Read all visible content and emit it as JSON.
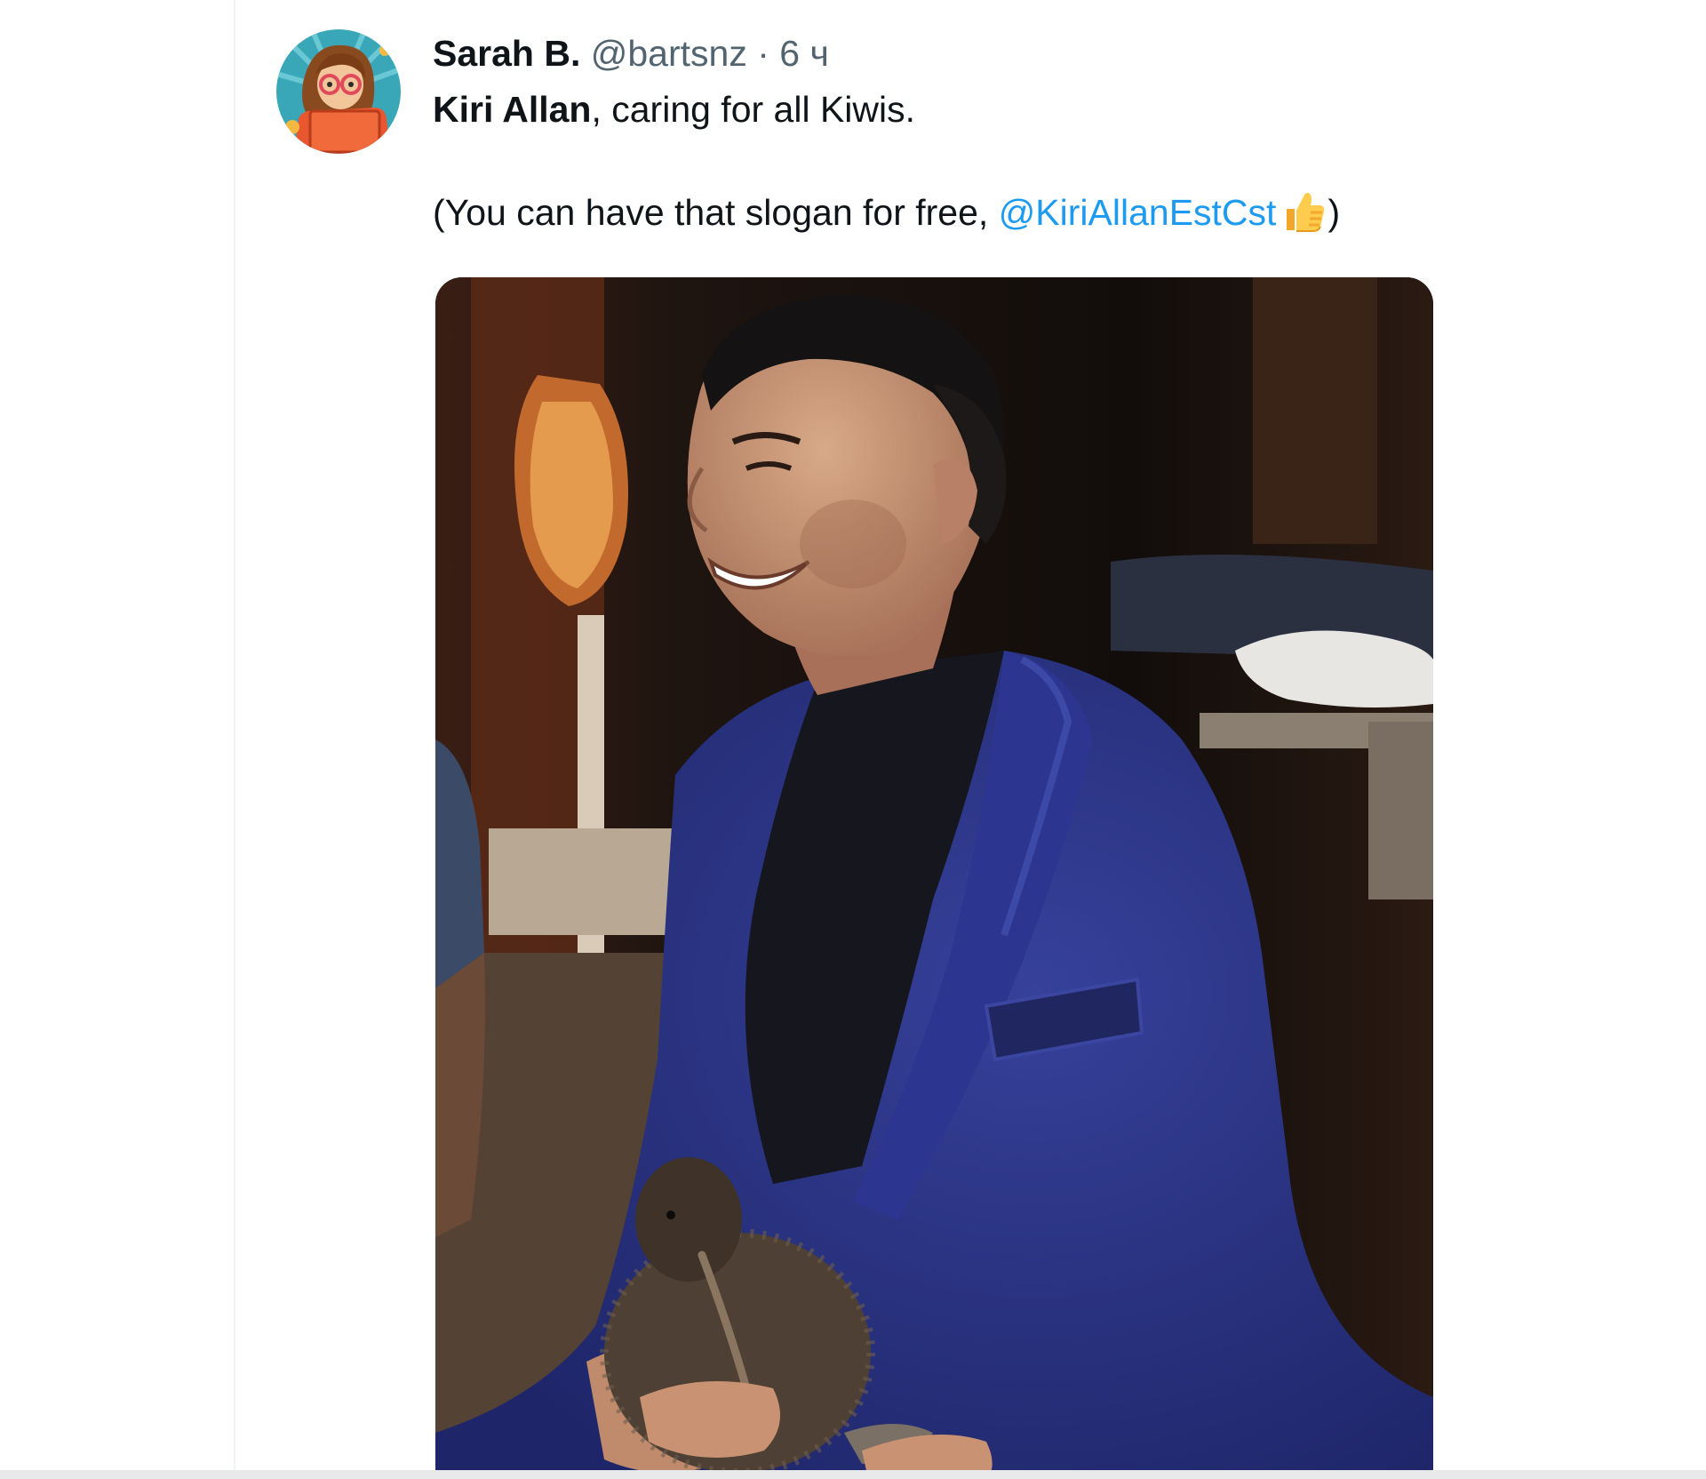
{
  "tweet": {
    "author": {
      "display_name": "Sarah B.",
      "handle": "@bartsnz",
      "avatar_icon": "illustrated-avatar"
    },
    "separator": "·",
    "timestamp": "6 ч",
    "text": {
      "bold_name": "Kiri Allan",
      "line1_rest": ", caring for all Kiwis.",
      "line2_prefix": "(You can have that slogan for free, ",
      "mention": "@KiriAllanEstCst",
      "emoji": "thumbs-up-emoji",
      "line2_suffix": ")"
    },
    "media": {
      "type": "photo",
      "icon": "photo-kiri-allan-holding-kiwi"
    }
  },
  "colors": {
    "text_primary": "#0f1419",
    "text_secondary": "#536471",
    "link": "#1d9bf0",
    "suit_blue": "#27307a",
    "divider": "#eff3f4"
  }
}
